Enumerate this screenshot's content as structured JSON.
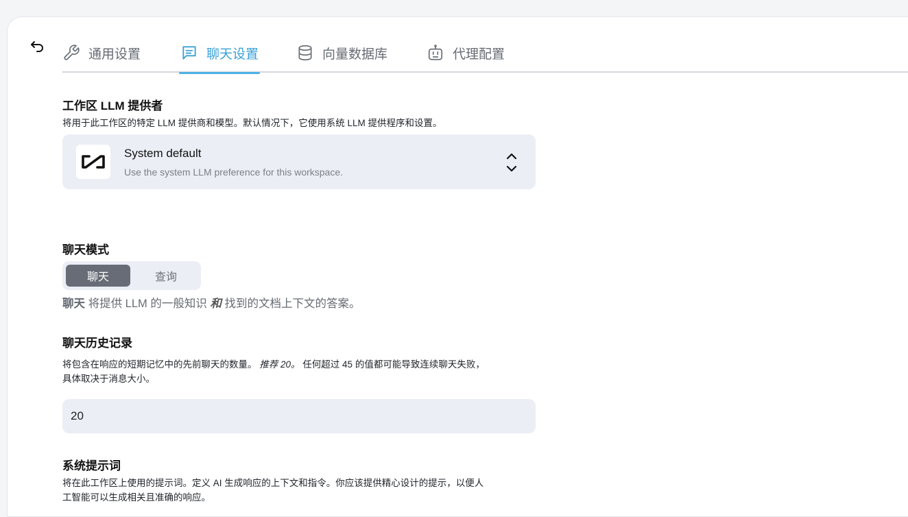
{
  "tabs": [
    {
      "label": "通用设置",
      "icon": "wrench-icon"
    },
    {
      "label": "聊天设置",
      "icon": "chat-bubble-icon"
    },
    {
      "label": "向量数据库",
      "icon": "database-icon"
    },
    {
      "label": "代理配置",
      "icon": "robot-icon"
    }
  ],
  "active_tab": "聊天设置",
  "llm_provider": {
    "title": "工作区 LLM 提供者",
    "description": "将用于此工作区的特定 LLM 提供商和模型。默认情况下，它使用系统 LLM 提供程序和设置。",
    "selected_name": "System default",
    "selected_description": "Use the system LLM preference for this workspace."
  },
  "chat_mode": {
    "title": "聊天模式",
    "options": [
      "聊天",
      "查询"
    ],
    "selected": "聊天",
    "desc_strong": "聊天",
    "desc_part1": " 将提供 LLM 的一般知识 ",
    "desc_em": "和",
    "desc_part2": " 找到的文档上下文的答案。"
  },
  "chat_history": {
    "title": "聊天历史记录",
    "desc_line1_a": "将包含在响应的短期记忆中的先前聊天的数量。",
    "desc_line1_em": "推荐 20。",
    "desc_line1_b": " 任何超过 45 的值都可能导致连续聊天失败，",
    "desc_line2": "具体取决于消息大小。",
    "value": "20"
  },
  "system_prompt": {
    "title": "系统提示词",
    "desc_line1": "将在此工作区上使用的提示词。定义 AI 生成响应的上下文和指令。你应该提供精心设计的提示，以便人",
    "desc_line2": "工智能可以生成相关且准确的响应。"
  },
  "colors": {
    "accent": "#3aa0d6",
    "field_bg": "#ebeef5",
    "toggle_active": "#676c76"
  }
}
